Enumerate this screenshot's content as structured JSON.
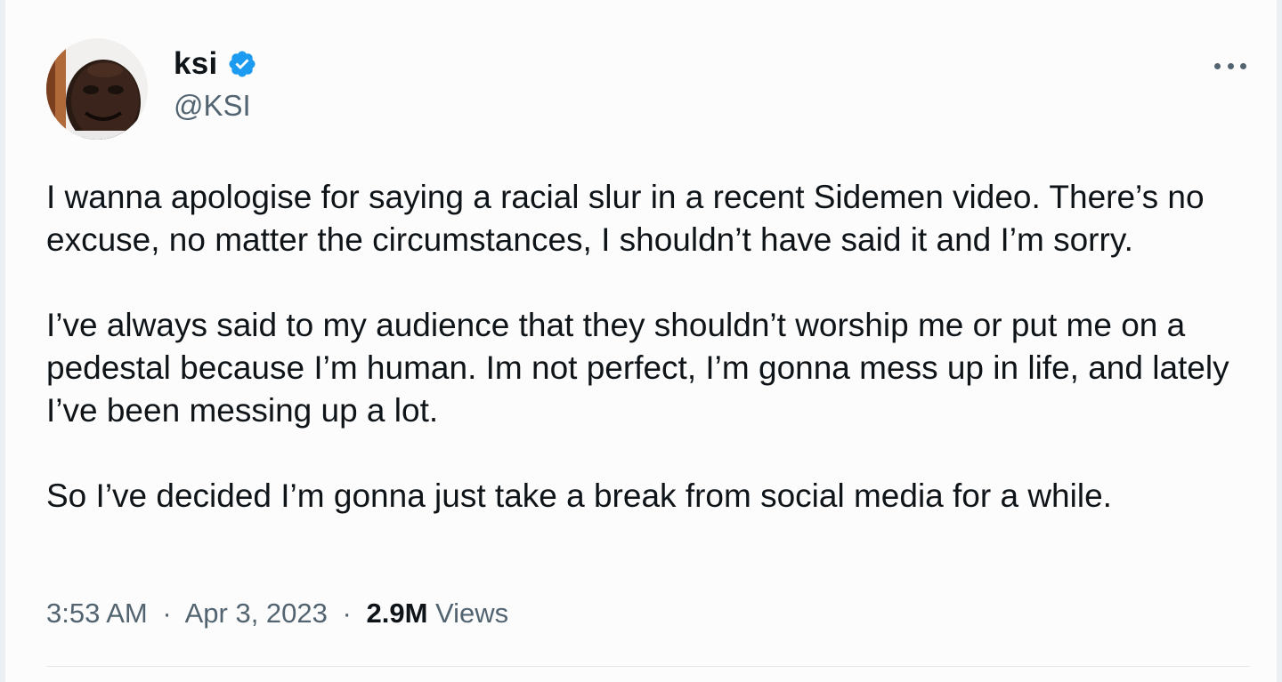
{
  "author": {
    "display_name": "ksi",
    "handle": "@KSI",
    "verified": true
  },
  "tweet": {
    "paragraphs": [
      "I wanna apologise for saying a racial slur in a recent Sidemen video. There’s no excuse, no matter the circumstances, I shouldn’t have said it and I’m sorry.",
      "I’ve always said to my audience that they shouldn’t worship me or put me on a pedestal because I’m human. Im not perfect, I’m gonna mess up in life, and lately I’ve been messing up a lot.",
      "So I’ve decided I’m gonna just take a break from social media for a while."
    ]
  },
  "meta": {
    "time": "3:53 AM",
    "separator": "·",
    "date": "Apr 3, 2023",
    "views_count": "2.9M",
    "views_label": "Views"
  },
  "icons": {
    "verified": "verified-badge-icon",
    "more": "more-options-icon"
  },
  "colors": {
    "primary_text": "#0f1419",
    "secondary_text": "#536471",
    "verified_blue": "#1d9bf0"
  }
}
